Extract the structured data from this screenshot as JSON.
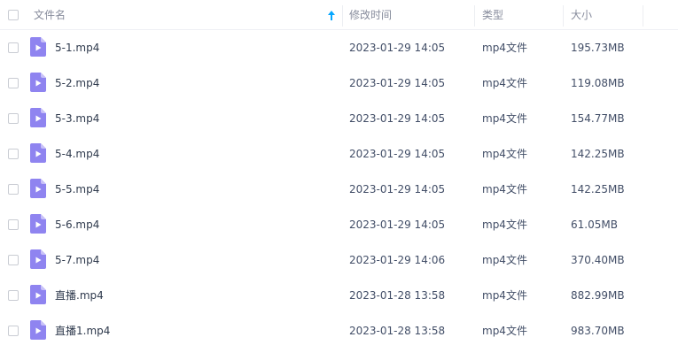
{
  "header": {
    "name_label": "文件名",
    "time_label": "修改时间",
    "type_label": "类型",
    "size_label": "大小",
    "sort_icon": "sort-ascending-arrow-icon"
  },
  "colors": {
    "file_icon": "#8f84f0",
    "header_text": "#878c9c",
    "row_text": "#424e67",
    "sort_arrow": "#06a7ff"
  },
  "files": [
    {
      "name": "5-1.mp4",
      "modified": "2023-01-29 14:05",
      "type": "mp4文件",
      "size": "195.73MB",
      "icon": "video-file-icon"
    },
    {
      "name": "5-2.mp4",
      "modified": "2023-01-29 14:05",
      "type": "mp4文件",
      "size": "119.08MB",
      "icon": "video-file-icon"
    },
    {
      "name": "5-3.mp4",
      "modified": "2023-01-29 14:05",
      "type": "mp4文件",
      "size": "154.77MB",
      "icon": "video-file-icon"
    },
    {
      "name": "5-4.mp4",
      "modified": "2023-01-29 14:05",
      "type": "mp4文件",
      "size": "142.25MB",
      "icon": "video-file-icon"
    },
    {
      "name": "5-5.mp4",
      "modified": "2023-01-29 14:05",
      "type": "mp4文件",
      "size": "142.25MB",
      "icon": "video-file-icon"
    },
    {
      "name": "5-6.mp4",
      "modified": "2023-01-29 14:05",
      "type": "mp4文件",
      "size": "61.05MB",
      "icon": "video-file-icon"
    },
    {
      "name": "5-7.mp4",
      "modified": "2023-01-29 14:06",
      "type": "mp4文件",
      "size": "370.40MB",
      "icon": "video-file-icon"
    },
    {
      "name": "直播.mp4",
      "modified": "2023-01-28 13:58",
      "type": "mp4文件",
      "size": "882.99MB",
      "icon": "video-file-icon"
    },
    {
      "name": "直播1.mp4",
      "modified": "2023-01-28 13:58",
      "type": "mp4文件",
      "size": "983.70MB",
      "icon": "video-file-icon"
    }
  ]
}
